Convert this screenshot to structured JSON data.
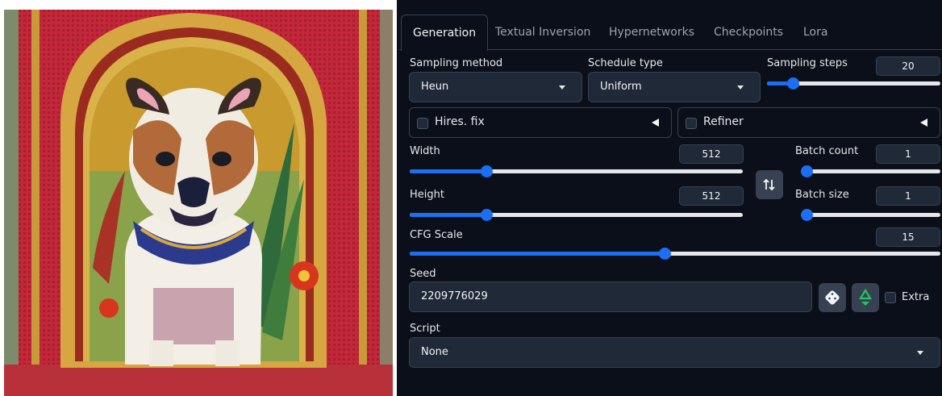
{
  "tabs": [
    "Generation",
    "Textual Inversion",
    "Hypernetworks",
    "Checkpoints",
    "Lora"
  ],
  "sampling_method": {
    "label": "Sampling method",
    "value": "Heun"
  },
  "schedule_type": {
    "label": "Schedule type",
    "value": "Uniform"
  },
  "sampling_steps": {
    "label": "Sampling steps",
    "value": "20",
    "fraction": 0.15
  },
  "hires_fix": {
    "label": "Hires. fix",
    "checked": false
  },
  "refiner": {
    "label": "Refiner",
    "checked": false
  },
  "width": {
    "label": "Width",
    "value": "512",
    "fraction": 0.23
  },
  "height": {
    "label": "Height",
    "value": "512",
    "fraction": 0.23
  },
  "batch_count": {
    "label": "Batch count",
    "value": "1",
    "fraction": 0.0
  },
  "batch_size": {
    "label": "Batch size",
    "value": "1",
    "fraction": 0.0
  },
  "cfg_scale": {
    "label": "CFG Scale",
    "value": "15",
    "fraction": 0.48
  },
  "seed": {
    "label": "Seed",
    "value": "2209776029"
  },
  "extra": {
    "label": "Extra",
    "checked": false
  },
  "script": {
    "label": "Script",
    "value": "None"
  },
  "icons": {
    "swap": "swap-dimensions-icon",
    "dice": "dice-icon",
    "recycle": "recycle-icon"
  },
  "colors": {
    "accent": "#1d6ff2",
    "background": "#0b0f19",
    "input": "#1f2937",
    "border": "#374151"
  }
}
